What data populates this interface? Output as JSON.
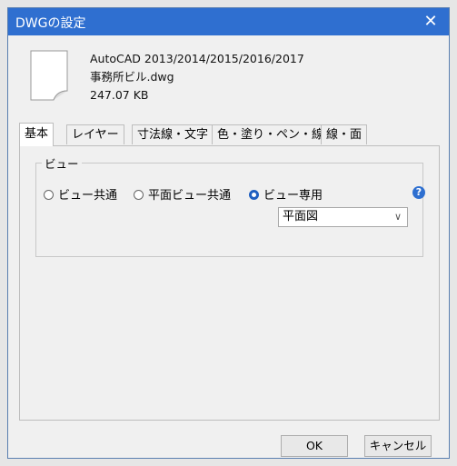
{
  "window": {
    "title": "DWGの設定",
    "close_glyph": "✕"
  },
  "file": {
    "format": "AutoCAD 2013/2014/2015/2016/2017",
    "name": "事務所ビル.dwg",
    "size": "247.07 KB"
  },
  "tabs": [
    {
      "label": "基本",
      "active": true
    },
    {
      "label": "レイヤー"
    },
    {
      "label": "寸法線・文字"
    },
    {
      "label": "色・塗り・ペン・線種"
    },
    {
      "label": "線・面"
    }
  ],
  "view_group": {
    "label": "ビュー",
    "options": [
      {
        "label": "ビュー共通",
        "selected": false
      },
      {
        "label": "平面ビュー共通",
        "selected": false
      },
      {
        "label": "ビュー専用",
        "selected": true
      }
    ],
    "view_select": {
      "value": "平面図"
    },
    "help_glyph": "?"
  },
  "buttons": {
    "ok": "OK",
    "cancel": "キャンセル"
  },
  "colors": {
    "titlebar": "#2f6fd0",
    "accent": "#1f5fc0"
  },
  "icons": [
    "close-icon",
    "file-icon",
    "help-icon",
    "chevron-down-icon"
  ]
}
